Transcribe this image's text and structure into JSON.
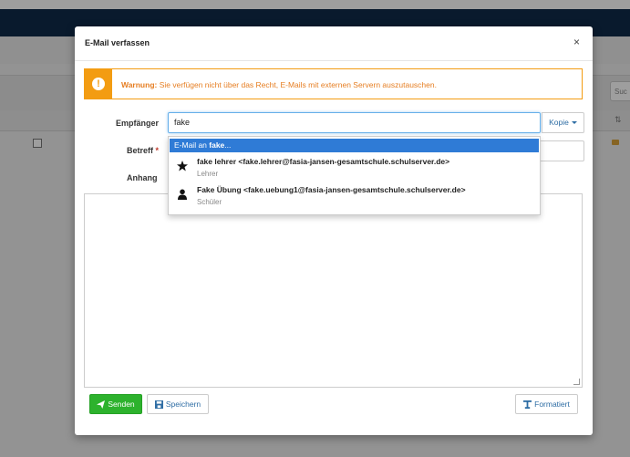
{
  "background": {
    "search_placeholder": "Suc",
    "sort_icon": "sort-icon"
  },
  "modal": {
    "title": "E-Mail verfassen",
    "close": "×",
    "warning": {
      "label": "Warnung:",
      "text": " Sie verfügen nicht über das Recht, E-Mails mit externen Servern auszutauschen.",
      "icon": "exclamation-icon",
      "color": "#f39c12"
    },
    "fields": {
      "to_label": "Empfänger",
      "to_value": "fake",
      "cc_button": "Kopie",
      "subject_label": "Betreff",
      "subject_required_mark": "*",
      "attachment_label": "Anhang"
    },
    "autocomplete": {
      "first_prefix": "E-Mail an ",
      "first_query": "fake",
      "first_suffix": "...",
      "items": [
        {
          "name": "fake lehrer <fake.lehrer@fasia-jansen-gesamtschule.schulserver.de>",
          "role": "Lehrer",
          "icon": "star-icon"
        },
        {
          "name": "Fake Übung <fake.uebung1@fasia-jansen-gesamtschule.schulserver.de>",
          "role": "Schüler",
          "icon": "user-icon"
        }
      ]
    },
    "buttons": {
      "send": "Senden",
      "save": "Speichern",
      "format": "Formatiert"
    },
    "colors": {
      "send": "#2db22d",
      "highlight": "#2f7bd6",
      "link": "#2e6da4"
    }
  }
}
